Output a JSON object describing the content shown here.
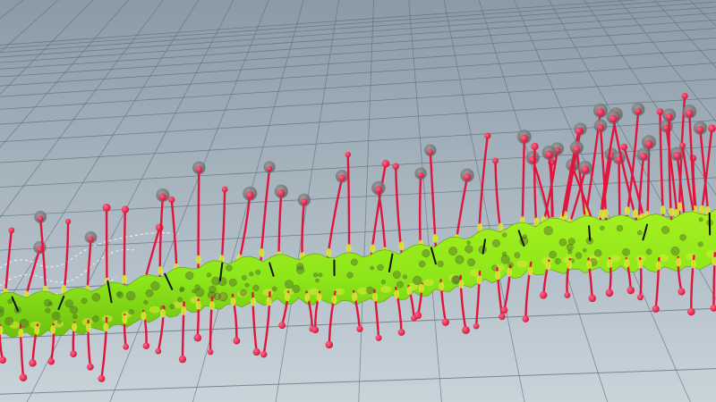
{
  "viewport": {
    "colors": {
      "sky_top": "#8a9ba7",
      "sky_bottom": "#c9d3da",
      "grid_line": "#5f6f7b",
      "body_green": "#8de619",
      "body_yellow": "#d7ea33",
      "spine_red": "#e0143c",
      "bulb_red": "#f01e46",
      "ghost_bulb": "#6f6f6f",
      "guide_curve": "#ffffff"
    },
    "icons": [
      "grid-floor",
      "green-stem-body",
      "red-tentacle",
      "ghost-sphere",
      "trail-curve"
    ]
  }
}
